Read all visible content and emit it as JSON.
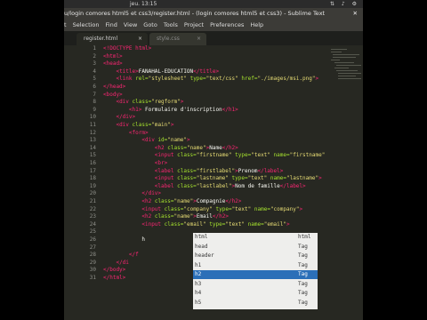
{
  "system": {
    "clock": "jeu. 13:15"
  },
  "window": {
    "title": "u/login comores html5 et css3/register.html - (login comores html5 et css3) - Sublime Text",
    "close_glyph": "✕"
  },
  "menu": [
    "t",
    "Selection",
    "Find",
    "View",
    "Goto",
    "Tools",
    "Project",
    "Preferences",
    "Help"
  ],
  "tabs": [
    {
      "label": "register.html",
      "close": "×",
      "active": true
    },
    {
      "label": "style.css",
      "close": "×",
      "active": false
    }
  ],
  "editor": {
    "line_numbers": [
      "1",
      "2",
      "3",
      "4",
      "5",
      "6",
      "7",
      "8",
      "9",
      "10",
      "11",
      "12",
      "13",
      "14",
      "15",
      "16",
      "17",
      "18",
      "19",
      "20",
      "21",
      "22",
      "23",
      "24",
      "25",
      "26",
      "27",
      "28",
      "29",
      "30",
      "31"
    ]
  },
  "autocomplete": {
    "items": [
      {
        "name": "html",
        "kind": "html"
      },
      {
        "name": "head",
        "kind": "Tag"
      },
      {
        "name": "header",
        "kind": "Tag"
      },
      {
        "name": "h1",
        "kind": "Tag"
      },
      {
        "name": "h2",
        "kind": "Tag",
        "selected": true
      },
      {
        "name": "h3",
        "kind": "Tag"
      },
      {
        "name": "h4",
        "kind": "Tag"
      },
      {
        "name": "h5",
        "kind": "Tag"
      }
    ]
  },
  "colors": {
    "background": "#272822",
    "tag": "#f92672",
    "attribute": "#a6e22e",
    "string": "#e6db74",
    "selection": "#2b6fb8"
  }
}
